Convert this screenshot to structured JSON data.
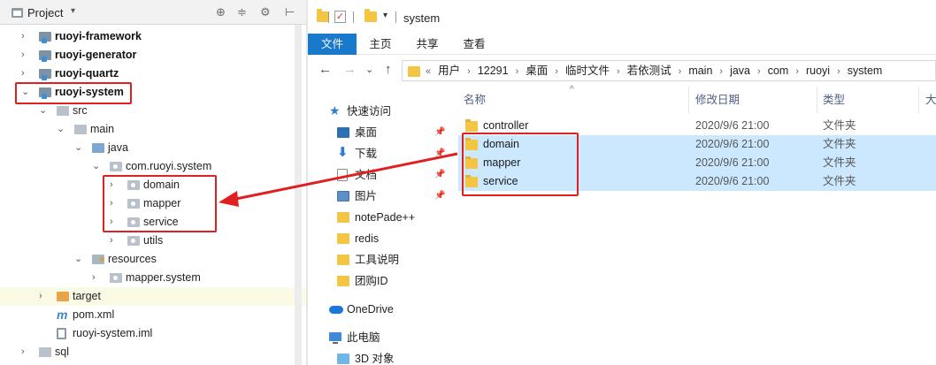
{
  "ide": {
    "header": {
      "title": "Project",
      "dropdown": "▾",
      "tools": [
        "⊕",
        "≑",
        "⚙",
        "⊢"
      ]
    },
    "tree": [
      {
        "label": "ruoyi-framework",
        "icon": "module",
        "bold": true,
        "arrow": "›"
      },
      {
        "label": "ruoyi-generator",
        "icon": "module",
        "bold": true,
        "arrow": "›"
      },
      {
        "label": "ruoyi-quartz",
        "icon": "module",
        "bold": true,
        "arrow": "›"
      },
      {
        "label": "ruoyi-system",
        "icon": "module",
        "bold": true,
        "arrow": "⌄"
      },
      {
        "label": "src",
        "icon": "folder",
        "arrow": "⌄"
      },
      {
        "label": "main",
        "icon": "folder",
        "arrow": "⌄"
      },
      {
        "label": "java",
        "icon": "java",
        "arrow": "⌄"
      },
      {
        "label": "com.ruoyi.system",
        "icon": "package",
        "arrow": "⌄"
      },
      {
        "label": "domain",
        "icon": "package",
        "arrow": "›"
      },
      {
        "label": "mapper",
        "icon": "package",
        "arrow": "›"
      },
      {
        "label": "service",
        "icon": "package",
        "arrow": "›"
      },
      {
        "label": "utils",
        "icon": "package",
        "arrow": "›"
      },
      {
        "label": "resources",
        "icon": "resources",
        "arrow": "⌄"
      },
      {
        "label": "mapper.system",
        "icon": "package",
        "arrow": "›"
      },
      {
        "label": "target",
        "icon": "target",
        "arrow": "›"
      },
      {
        "label": "pom.xml",
        "icon": "pom",
        "pom_glyph": "m"
      },
      {
        "label": "ruoyi-system.iml",
        "icon": "iml"
      },
      {
        "label": "sql",
        "icon": "folder",
        "arrow": "›"
      }
    ]
  },
  "explorer": {
    "title": "system",
    "qat": {
      "check_glyph": "✓",
      "dropdown": "▾"
    },
    "ribbon": {
      "tabs": [
        "文件",
        "主页",
        "共享",
        "查看"
      ]
    },
    "nav_buttons": {
      "back": "←",
      "forward": "→",
      "recent": "⌄",
      "up": "↑"
    },
    "address": {
      "prefix": "«",
      "separator": "›",
      "crumbs": [
        "用户",
        "12291",
        "桌面",
        "临时文件",
        "若依测试",
        "main",
        "java",
        "com",
        "ruoyi",
        "system"
      ]
    },
    "nav_pane": {
      "pin_glyph": "📌",
      "items": [
        {
          "label": "快速访问",
          "icon": "star",
          "glyph": "★"
        },
        {
          "label": "桌面",
          "icon": "desk",
          "pinned": true
        },
        {
          "label": "下载",
          "icon": "down",
          "glyph": "⬇",
          "pinned": true
        },
        {
          "label": "文档",
          "icon": "doc",
          "pinned": true
        },
        {
          "label": "图片",
          "icon": "pic",
          "pinned": true
        },
        {
          "label": "notePade++",
          "icon": "folder"
        },
        {
          "label": "redis",
          "icon": "folder"
        },
        {
          "label": "工具说明",
          "icon": "folder"
        },
        {
          "label": "团购ID",
          "icon": "folder"
        },
        {
          "label": "OneDrive",
          "icon": "cloud"
        },
        {
          "label": "此电脑",
          "icon": "pc"
        },
        {
          "label": "3D 对象",
          "icon": "3d"
        }
      ]
    },
    "columns": {
      "name": "名称",
      "modified": "修改日期",
      "type": "类型",
      "size": "大",
      "sort_caret": "^"
    },
    "files": [
      {
        "name": "controller",
        "modified": "2020/9/6 21:00",
        "type": "文件夹",
        "selected": false
      },
      {
        "name": "domain",
        "modified": "2020/9/6 21:00",
        "type": "文件夹",
        "selected": true
      },
      {
        "name": "mapper",
        "modified": "2020/9/6 21:00",
        "type": "文件夹",
        "selected": true
      },
      {
        "name": "service",
        "modified": "2020/9/6 21:00",
        "type": "文件夹",
        "selected": true
      }
    ]
  },
  "colors": {
    "annotation_red": "#e02020",
    "ribbon_active": "#1979ca",
    "selection": "#cce8ff",
    "folder_yellow": "#f3c543"
  }
}
